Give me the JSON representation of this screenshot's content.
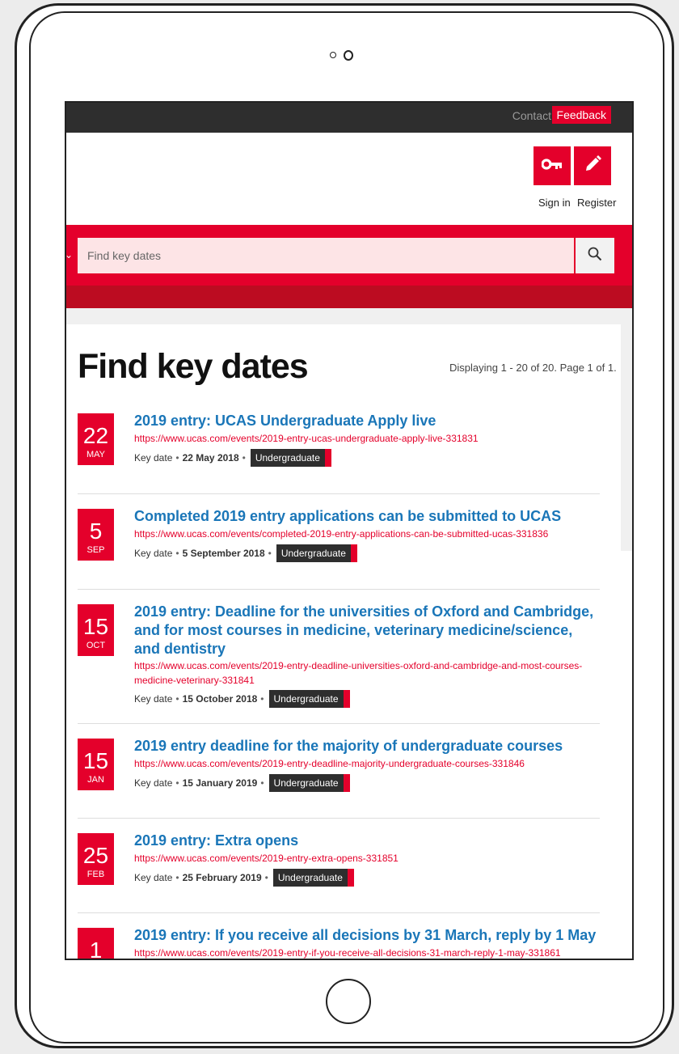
{
  "topbar": {
    "contact": "Contact",
    "feedback": "Feedback"
  },
  "account": {
    "sign_in": "Sign in",
    "register": "Register"
  },
  "search": {
    "placeholder": "Find key dates"
  },
  "page": {
    "title": "Find key dates",
    "displaying": "Displaying 1 - 20 of 20. Page 1 of 1."
  },
  "key_date_label": "Key date",
  "events": [
    {
      "day": "22",
      "month": "MAY",
      "title": "2019 entry: UCAS Undergraduate Apply live",
      "url": "https://www.ucas.com/events/2019-entry-ucas-undergraduate-apply-live-331831",
      "date": "22 May 2018",
      "tag": "Undergraduate"
    },
    {
      "day": "5",
      "month": "SEP",
      "title": "Completed 2019 entry applications can be submitted to UCAS",
      "url": "https://www.ucas.com/events/completed-2019-entry-applications-can-be-submitted-ucas-331836",
      "date": "5 September 2018",
      "tag": "Undergraduate"
    },
    {
      "day": "15",
      "month": "OCT",
      "title": "2019 entry: Deadline for the universities of Oxford and Cambridge, and for most courses in medicine, veterinary medicine/science, and dentistry",
      "url": "https://www.ucas.com/events/2019-entry-deadline-universities-oxford-and-cambridge-and-most-courses-medicine-veterinary-331841",
      "date": "15 October 2018",
      "tag": "Undergraduate"
    },
    {
      "day": "15",
      "month": "JAN",
      "title": "2019 entry deadline for the majority of undergraduate courses",
      "url": "https://www.ucas.com/events/2019-entry-deadline-majority-undergraduate-courses-331846",
      "date": "15 January 2019",
      "tag": "Undergraduate"
    },
    {
      "day": "25",
      "month": "FEB",
      "title": "2019 entry: Extra opens",
      "url": "https://www.ucas.com/events/2019-entry-extra-opens-331851",
      "date": "25 February 2019",
      "tag": "Undergraduate"
    },
    {
      "day": "1",
      "month": "",
      "title": "2019 entry: If you receive all decisions by 31 March, reply by 1 May",
      "url": "https://www.ucas.com/events/2019-entry-if-you-receive-all-decisions-31-march-reply-1-may-331861",
      "date": "",
      "tag": ""
    }
  ]
}
